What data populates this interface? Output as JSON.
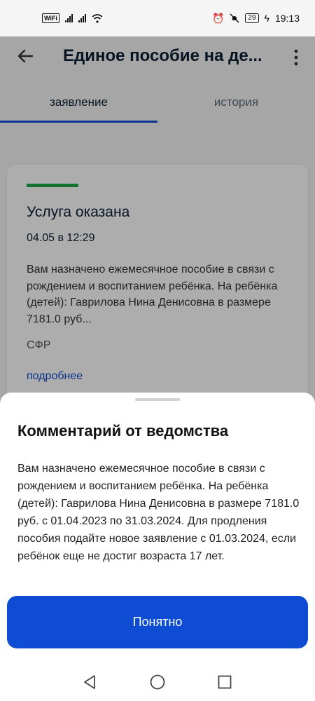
{
  "status_bar": {
    "wifi_label": "WiFi",
    "battery": "29",
    "time": "19:13",
    "icons": [
      "signal-icon",
      "wifi-icon",
      "alarm-icon",
      "mute-icon",
      "battery-icon",
      "charging-icon"
    ]
  },
  "header": {
    "title": "Единое пособие на де..."
  },
  "tabs": [
    {
      "label": "заявление",
      "active": true
    },
    {
      "label": "история",
      "active": false
    }
  ],
  "card": {
    "status": "Услуга оказана",
    "date": "04.05 в 12:29",
    "text": "Вам назначено ежемесячное пособие в связи с рождением и воспитанием ребёнка. На ребёнка (детей): Гаврилова Нина Денисовна в размере 7181.0 руб...",
    "agency": "СФР",
    "link": "подробнее",
    "status_color": "#1ea74a"
  },
  "sheet": {
    "title": "Комментарий от ведомства",
    "text": "Вам назначено ежемесячное пособие в связи с рождением и воспитанием ребёнка. На ребёнка (детей): Гаврилова Нина Денисовна в размере 7181.0 руб. с 01.04.2023 по 31.03.2024. Для продления пособия подайте новое заявление с 01.03.2024, если ребёнок еще не достиг возраста 17 лет.",
    "button": "Понятно"
  },
  "colors": {
    "accent": "#0d4cd3",
    "success": "#1ea74a"
  }
}
